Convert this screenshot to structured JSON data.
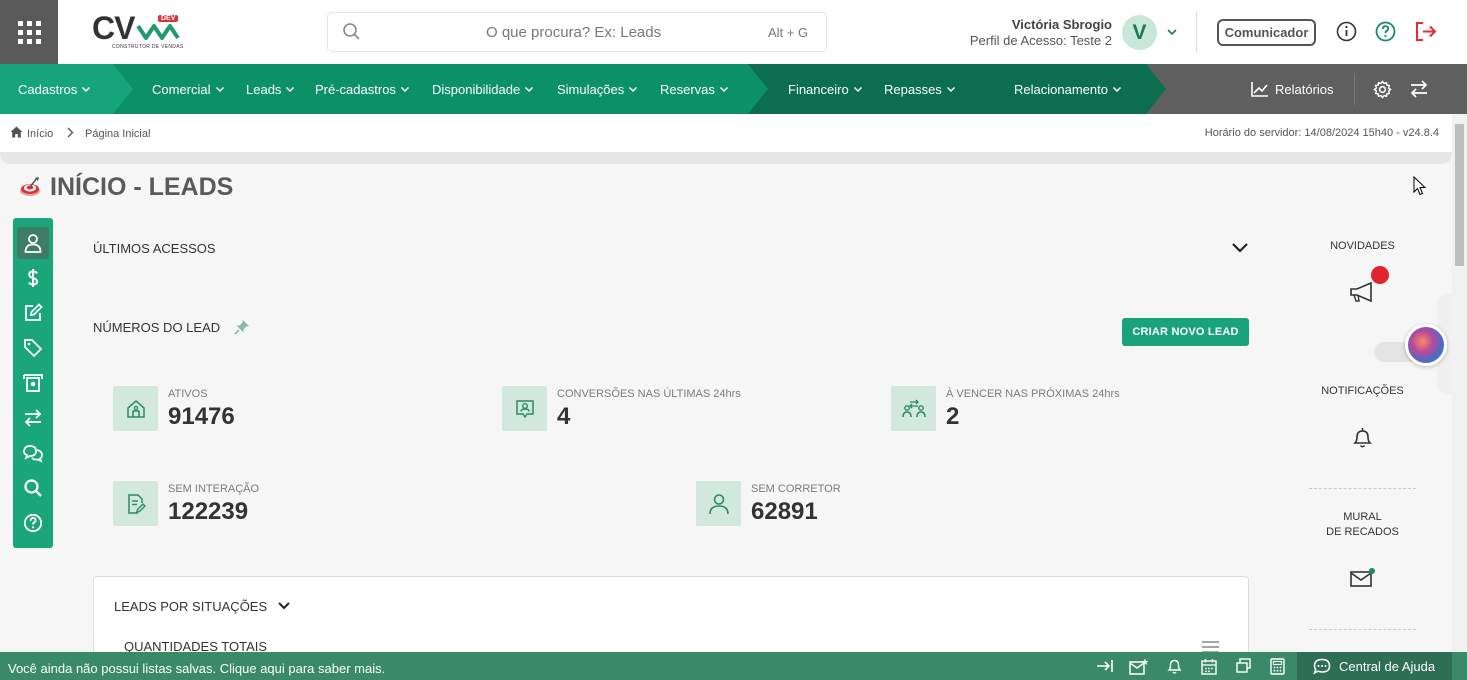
{
  "header": {
    "logo_text": "CV",
    "logo_badge": "DEV",
    "logo_sub": "CONSTRUTOR DE VENDAS",
    "search_placeholder": "O que procura? Ex: Leads",
    "search_shortcut": "Alt + G",
    "user_name": "Victória Sbrogio",
    "user_profile": "Perfil de Acesso: Teste 2",
    "avatar_letter": "V",
    "comunicador_label": "Comunicador"
  },
  "nav": {
    "items": [
      {
        "label": "Cadastros"
      },
      {
        "label": "Comercial"
      },
      {
        "label": "Leads"
      },
      {
        "label": "Pré-cadastros"
      },
      {
        "label": "Disponibilidade"
      },
      {
        "label": "Simulações"
      },
      {
        "label": "Reservas"
      },
      {
        "label": "Financeiro"
      },
      {
        "label": "Repasses"
      },
      {
        "label": "Relacionamento"
      }
    ],
    "relatorios_label": "Relatórios",
    "colors": {
      "segment1": "#16a47a",
      "segment2": "#0c9166",
      "segment3": "#0b6f4f",
      "rest": "#5f5f5f"
    }
  },
  "breadcrumb": {
    "home": "Início",
    "current": "Página Inicial",
    "server_time": "Horário do servidor: 14/08/2024 15h40 - v24.8.4"
  },
  "page": {
    "title": "INÍCIO - LEADS",
    "ultimos_acessos": "ÚLTIMOS ACESSOS",
    "numeros_do_lead": "NÚMEROS DO LEAD",
    "criar_novo_lead": "CRIAR NOVO LEAD",
    "stats": [
      {
        "label": "ATIVOS",
        "value": "91476",
        "icon": "house-icon"
      },
      {
        "label": "CONVERSÕES NAS ÚLTIMAS 24hrs",
        "value": "4",
        "icon": "user-badge-icon"
      },
      {
        "label": "À VENCER NAS PRÓXIMAS 24hrs",
        "value": "2",
        "icon": "users-exchange-icon"
      },
      {
        "label": "SEM INTERAÇÃO",
        "value": "122239",
        "icon": "document-edit-icon"
      },
      {
        "label": "SEM CORRETOR",
        "value": "62891",
        "icon": "user-icon"
      }
    ],
    "leads_por_situacoes": "LEADS POR SITUAÇÕES",
    "quantidades_totais": "QUANTIDADES TOTAIS"
  },
  "right_panel": {
    "novidades": "NOVIDADES",
    "notificacoes": "NOTIFICAÇÕES",
    "mural_line1": "MURAL",
    "mural_line2": "DE RECADOS"
  },
  "bottom": {
    "message": "Você ainda não possui listas salvas. Clique aqui para saber mais.",
    "help_label": "Central de Ajuda"
  }
}
